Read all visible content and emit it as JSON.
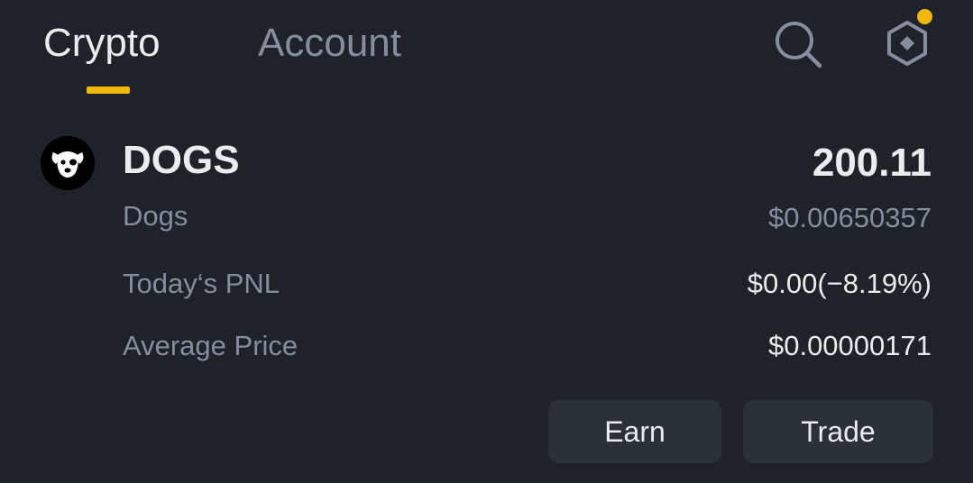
{
  "tabs": [
    {
      "label": "Crypto",
      "active": true
    },
    {
      "label": "Account",
      "active": false
    }
  ],
  "icons": {
    "search": "search-icon",
    "settings": "hexagon-settings-icon",
    "notification_dot_color": "#f0b90b"
  },
  "accent_color": "#f0b90b",
  "asset": {
    "symbol": "DOGS",
    "name": "Dogs",
    "amount": "200.11",
    "price": "$0.00650357",
    "todays_pnl_label": "Today‘s PNL",
    "todays_pnl_value": "$0.00(−8.19%)",
    "average_price_label": "Average Price",
    "average_price_value": "$0.00000171"
  },
  "actions": {
    "earn_label": "Earn",
    "trade_label": "Trade"
  }
}
